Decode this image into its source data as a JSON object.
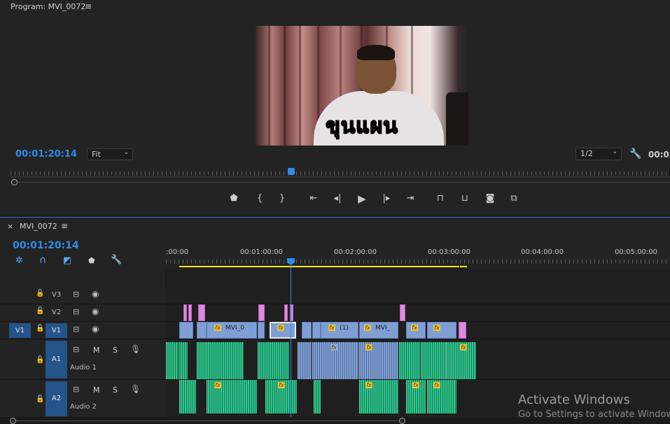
{
  "program": {
    "title": "Program: MVI_0072",
    "menu_icon": "≡",
    "timecode": "00:01:20:14",
    "fit_label": "Fit",
    "resolution_label": "1/2",
    "timecode_right": "00:0",
    "caption_text": "ขุนแผน"
  },
  "transport": {
    "buttons": [
      {
        "name": "add-marker-icon",
        "glyph": "⬢"
      },
      {
        "name": "mark-in-icon",
        "glyph": "{"
      },
      {
        "name": "mark-out-icon",
        "glyph": "}"
      },
      {
        "name": "go-to-in-icon",
        "glyph": "|◀"
      },
      {
        "name": "step-back-icon",
        "glyph": "◀|"
      },
      {
        "name": "play-icon",
        "glyph": "▶"
      },
      {
        "name": "step-forward-icon",
        "glyph": "|▶"
      },
      {
        "name": "go-to-out-icon",
        "glyph": "▶|"
      },
      {
        "name": "lift-icon",
        "glyph": "⏏"
      },
      {
        "name": "extract-icon",
        "glyph": "⏏"
      },
      {
        "name": "export-frame-icon",
        "glyph": "📷"
      },
      {
        "name": "comparison-view-icon",
        "glyph": "⧉"
      }
    ]
  },
  "timeline": {
    "close_icon": "×",
    "sequence_name": "MVI_0072",
    "menu_icon": "≡",
    "timecode": "00:01:20:14",
    "ruler_labels": [
      ":00:00",
      "00:01:00:00",
      "00:02:00:00",
      "00:03:00:00",
      "00:04:00:00",
      "00:05:00:00"
    ],
    "tracks": {
      "v3": "V3",
      "v2": "V2",
      "v1": "V1",
      "v1_source": "V1",
      "a1": "A1",
      "a1_name": "Audio 1",
      "a2": "A2",
      "a2_name": "Audio 2",
      "mute": "M",
      "solo": "S"
    },
    "clip_labels": {
      "clip1": "MVI_0",
      "clip2": "(1)",
      "clip3": "MVI_"
    },
    "fx_label": "fx"
  },
  "watermark": {
    "line1": "Activate Windows",
    "line2": "Go to Settings to activate Windows."
  },
  "colors": {
    "accent_blue": "#2d8ceb",
    "video_clip": "#7f9fd4",
    "audio_clip": "#2ec48c",
    "transition": "#dc8ae0",
    "work_area": "#f1e01b"
  }
}
